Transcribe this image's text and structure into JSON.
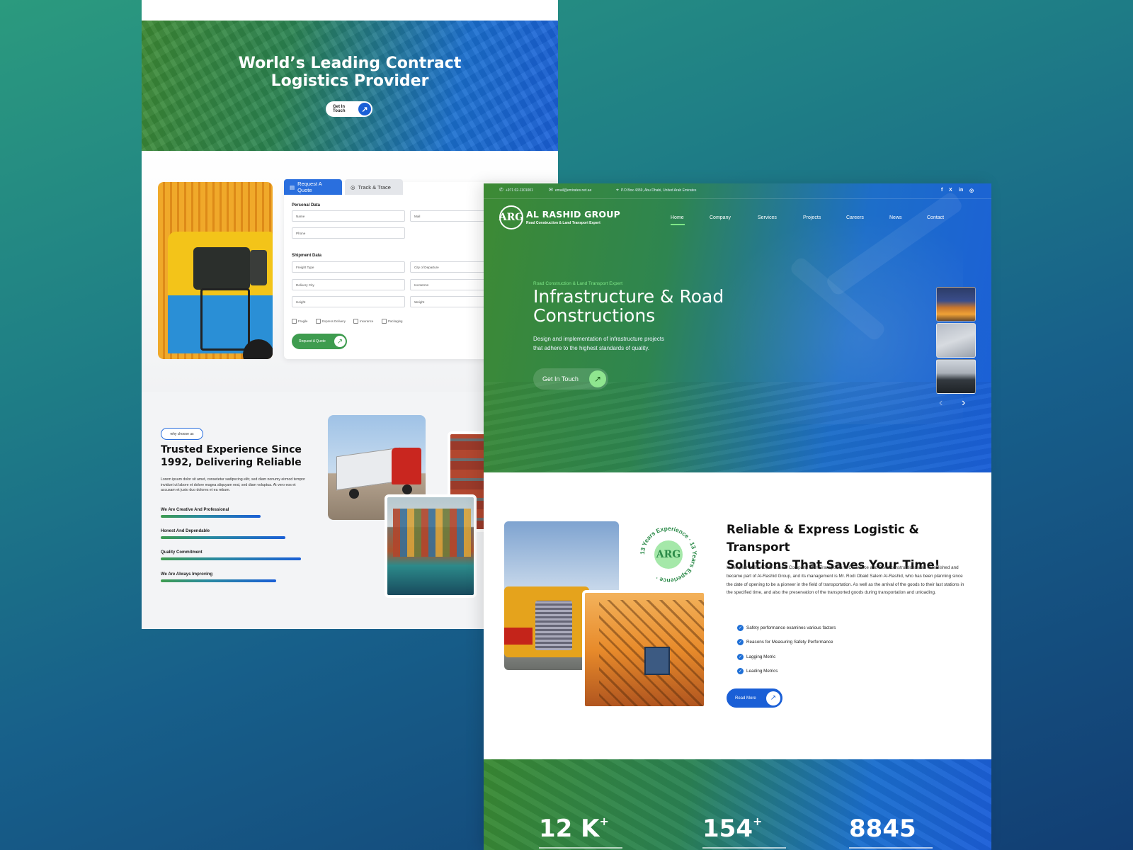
{
  "back_page": {
    "hero": {
      "title": "World’s Leading Contract\nLogistics Provider",
      "button_label": "Get In Touch"
    },
    "quote_form": {
      "tabs": [
        "Request A Quote",
        "Track & Trace"
      ],
      "personal_heading": "Personal Data",
      "personal_fields": [
        "Name",
        "Mail",
        "Phone"
      ],
      "shipment_heading": "Shipment Data",
      "shipment_fields": [
        "Freight Type",
        "City of Departure",
        "Delivery City",
        "Incoterms",
        "Height",
        "Weight"
      ],
      "checkboxes": [
        "Fragile",
        "Express Delivery",
        "Insurance",
        "Packaging"
      ],
      "submit_label": "Request A Quote"
    },
    "why_choose": {
      "badge": "why choose us",
      "title": "Trusted Experience Since 1992, Delivering Reliable",
      "body": "Lorem ipsum dolor sit amet, consetetur sadipscing elitr, sed diam nonumy eirmod tempor invidunt ut labore et dolore magna aliquyam erat, sed diam voluptua. At vero eos et accusam et justo duo dolores et ea rebum.",
      "skills": [
        {
          "label": "We Are Creative And Professional",
          "level": 0.64
        },
        {
          "label": "Honest And Dependable",
          "level": 0.8
        },
        {
          "label": "Quality Commitment",
          "level": 0.9
        },
        {
          "label": "We Are Always Improving",
          "level": 0.74
        }
      ]
    }
  },
  "front_page": {
    "topbar": {
      "phone": "+971 02-1101001",
      "email": "email@emirates.net.ae",
      "address": "P.O Box 4359, Abu Dhabi, United Arab Emirates",
      "social_icons": [
        "facebook-icon",
        "x-icon",
        "linkedin-icon",
        "instagram-icon"
      ]
    },
    "logo": {
      "mark": "ARG",
      "name": "AL RASHID GROUP",
      "tagline": "Road Construction & Land Transport Expert"
    },
    "nav": [
      "Home",
      "Company",
      "Services",
      "Projects",
      "Careers",
      "News",
      "Contact"
    ],
    "active_nav": "Home",
    "hero": {
      "subtitle": "Road Construction & Land Transport Expert",
      "title": "Infrastructure & Road\nConstructions",
      "description": "Design and implementation of infrastructure projects\nthat adhere to the highest standards of quality.",
      "button_label": "Get In Touch",
      "slider_prev": "‹",
      "slider_next": "›"
    },
    "about": {
      "badge_text": "13 Years Experience · 13 Years Experience ·",
      "badge_mark": "ARG",
      "title": "Reliable & Express Logistic & Transport\nSolutions That Saves Your Time!",
      "body": "In the year 1991 AD, Al-Rashid Company Start Transport and Clearance and Road constructions was established and became part of Al-Rashid Group, and its management is Mr. Rodi Obaid Salem Al-Rashid, who has been planning since the date of opening to be a pioneer in the field of transportation. As well as the arrival of the goods to their last stations in the specified time, and also the preservation of the transported goods during transportation and unloading.",
      "checklist": [
        "Safety performance examines various factors",
        "Reasons for Measuring Safety Performance",
        "Lagging Metric",
        "Leading Metrics"
      ],
      "button_label": "Read More"
    },
    "stats": [
      {
        "value": "12 K",
        "suffix": "+"
      },
      {
        "value": "154",
        "suffix": "+"
      },
      {
        "value": "8845",
        "suffix": ""
      }
    ]
  },
  "colors": {
    "brand_green": "#3e9c4f",
    "brand_blue": "#1a5fd6",
    "accent_light_green": "#7ee787"
  }
}
